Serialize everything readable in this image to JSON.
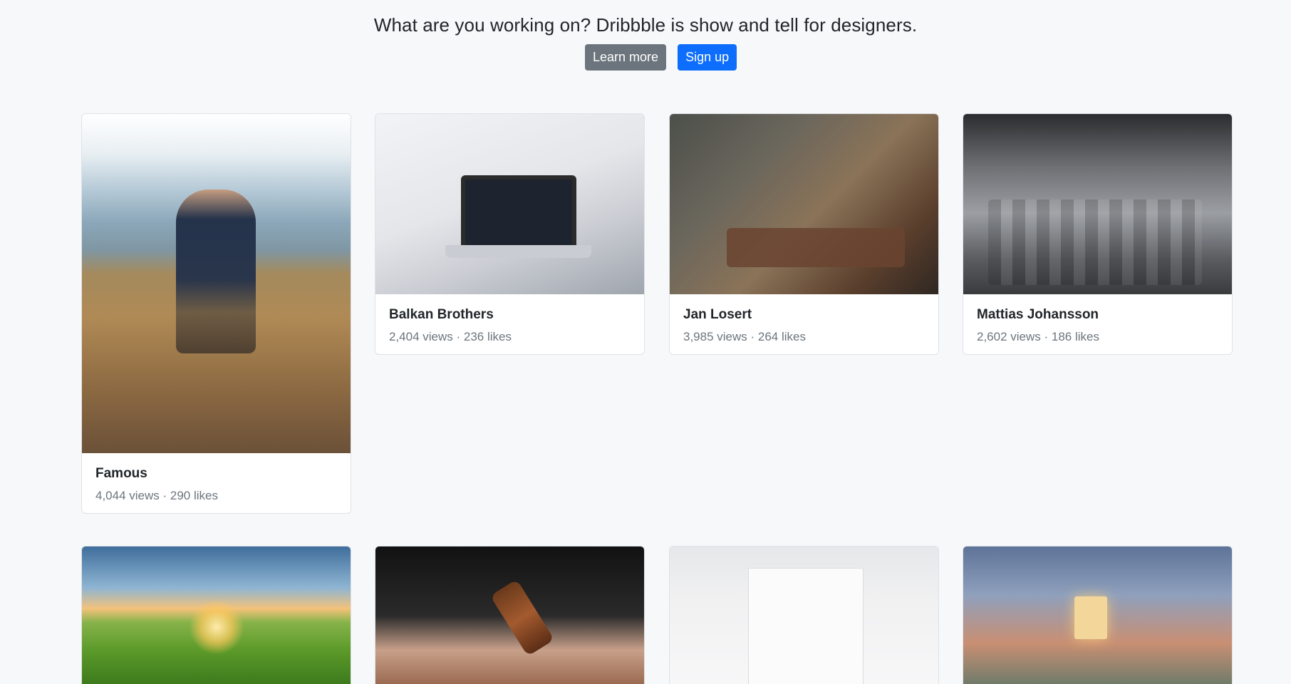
{
  "hero": {
    "headline": "What are you working on? Dribbble is show and tell for designers.",
    "learn_more_label": "Learn more",
    "sign_up_label": "Sign up"
  },
  "cards": [
    {
      "title": "Famous",
      "meta": "4,044 views · 290 likes"
    },
    {
      "title": "Balkan Brothers",
      "meta": "2,404 views · 236 likes"
    },
    {
      "title": "Jan Losert",
      "meta": "3,985 views · 264 likes"
    },
    {
      "title": "Mattias Johansson",
      "meta": "2,602 views · 186 likes"
    }
  ],
  "colors": {
    "page_background": "#f7f8fa",
    "primary": "#0d6efd",
    "secondary": "#6c757d",
    "card_border": "#dfe2e6"
  }
}
